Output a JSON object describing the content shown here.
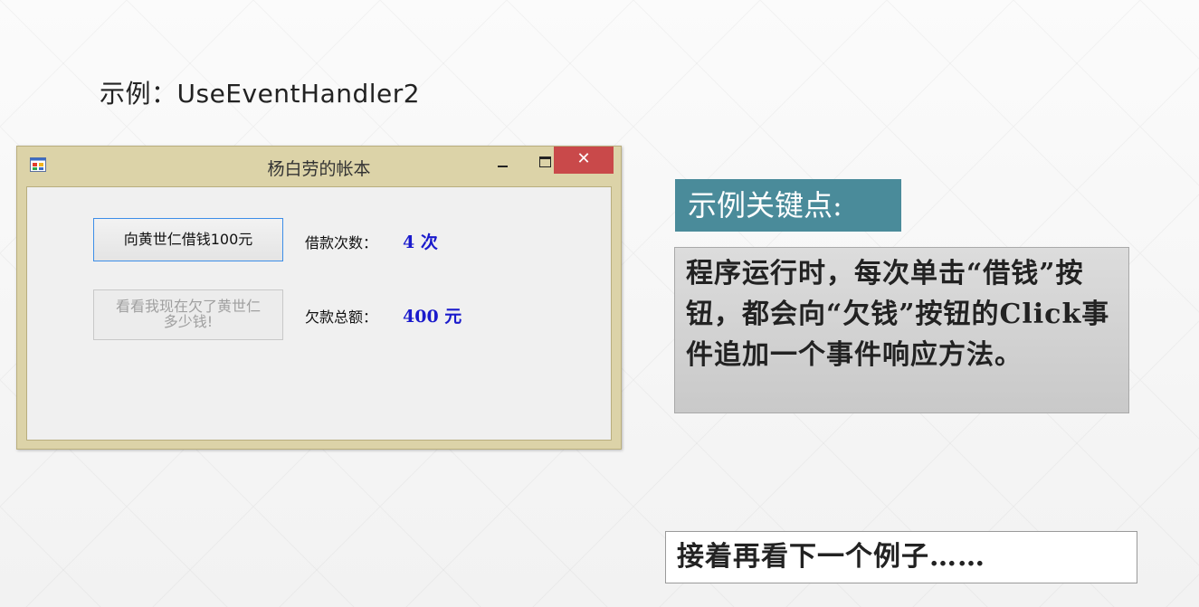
{
  "slide": {
    "title": "示例：UseEventHandler2"
  },
  "window": {
    "title": "杨白劳的帐本",
    "close_symbol": "✕",
    "borrow_button_label": "向黄世仁借钱100元",
    "check_button_line1": "看看我现在欠了黄世仁",
    "check_button_line2": "多少钱!",
    "count_label": "借款次数：",
    "count_value": "4 次",
    "total_label": "欠款总额：",
    "total_value": "400 元",
    "icons": {
      "app": "winform-app-icon",
      "minimize": "minimize-icon",
      "maximize": "maximize-icon",
      "close": "close-icon"
    },
    "colors": {
      "frame": "#dcd3a8",
      "close_button": "#c9494a",
      "value_text": "#1a1acc",
      "focus_border": "#3d8ee8"
    }
  },
  "key_points": {
    "heading": "示例关键点:",
    "body": "程序运行时，每次单击“借钱”按钮，都会向“欠钱”按钮的Click事件追加一个事件响应方法。",
    "colors": {
      "heading_bg": "#4a8b9a"
    }
  },
  "next_note": "接着再看下一个例子……"
}
